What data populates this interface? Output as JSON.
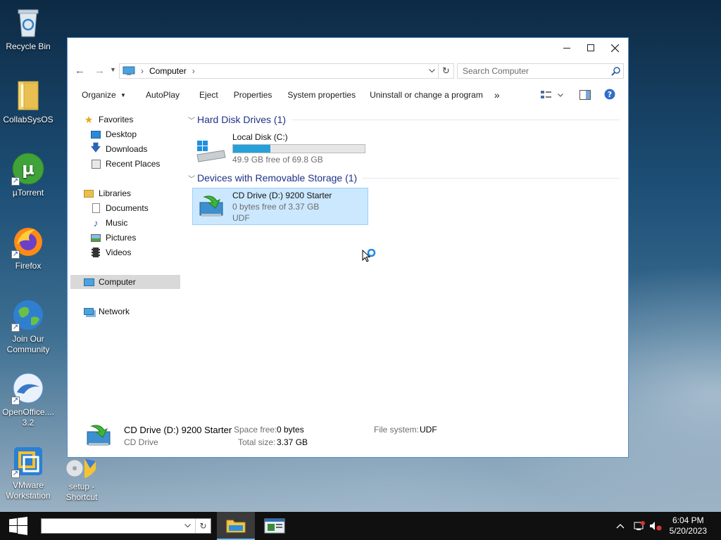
{
  "desktop": {
    "icons": [
      {
        "label": "Recycle Bin",
        "icon": "recycle-bin-icon"
      },
      {
        "label": "CollabSysOS",
        "icon": "folder-icon"
      },
      {
        "label": "µTorrent",
        "icon": "utorrent-icon"
      },
      {
        "label": "Firefox",
        "icon": "firefox-icon"
      },
      {
        "label": "Join Our Community",
        "icon": "globe-icon"
      },
      {
        "label": "OpenOffice.... 3.2",
        "icon": "openoffice-icon"
      },
      {
        "label": "VMware Workstation",
        "icon": "vmware-icon"
      },
      {
        "label": "setup - Shortcut",
        "icon": "setup-icon"
      }
    ]
  },
  "window": {
    "address": {
      "root": "Computer"
    },
    "search_placeholder": "Search Computer",
    "toolbar": {
      "organize": "Organize",
      "autoplay": "AutoPlay",
      "eject": "Eject",
      "properties": "Properties",
      "system_properties": "System properties",
      "uninstall": "Uninstall or change a program",
      "more": "»"
    },
    "nav": {
      "favorites": "Favorites",
      "desktop": "Desktop",
      "downloads": "Downloads",
      "recent": "Recent Places",
      "libraries": "Libraries",
      "documents": "Documents",
      "music": "Music",
      "pictures": "Pictures",
      "videos": "Videos",
      "computer": "Computer",
      "network": "Network"
    },
    "groups": {
      "hdd": "Hard Disk Drives (1)",
      "removable": "Devices with Removable Storage (1)"
    },
    "drives": {
      "c": {
        "name": "Local Disk (C:)",
        "free": "49.9 GB free of 69.8 GB",
        "used_fraction": 0.285
      },
      "d": {
        "name": "CD Drive (D:) 9200 Starter",
        "free": "0 bytes free of 3.37 GB",
        "fs": "UDF"
      }
    },
    "details": {
      "title": "CD Drive (D:) 9200 Starter",
      "type": "CD Drive",
      "space_free_label": "Space free:",
      "space_free": "0 bytes",
      "total_size_label": "Total size:",
      "total_size": "3.37 GB",
      "fs_label": "File system:",
      "fs": "UDF"
    }
  },
  "taskbar": {
    "time": "6:04 PM",
    "date": "5/20/2023"
  },
  "colors": {
    "accent": "#26a0da",
    "selection": "#cce8ff",
    "header": "#1e3287"
  }
}
